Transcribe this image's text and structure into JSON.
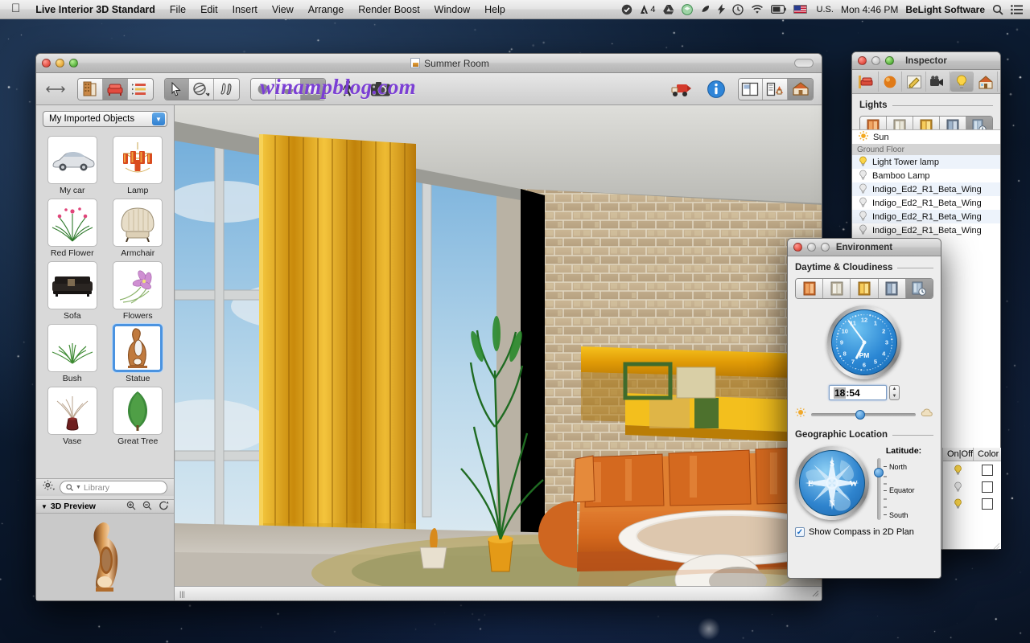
{
  "menubar": {
    "apple_icon": "apple-icon",
    "app_name": "Live Interior 3D Standard",
    "items": [
      "File",
      "Edit",
      "Insert",
      "View",
      "Arrange",
      "Render Boost",
      "Window",
      "Help"
    ],
    "status_icons": [
      "checkmark-badge-icon",
      "adobe-icon",
      "google-drive-icon",
      "dropbox-icon",
      "evernote-icon",
      "flash-icon",
      "time-machine-icon",
      "wifi-icon",
      "battery-icon"
    ],
    "adobe_badge": "4",
    "input_locale": "U.S.",
    "clock": "Mon 4:46 PM",
    "user": "BeLight Software",
    "spotlight_icon": "search-icon",
    "notification_icon": "notification-list-icon"
  },
  "main_window": {
    "document_title": "Summer Room",
    "watermark": "winampblog.com",
    "toolbar": {
      "resize_icon": "arrows-horizontal-icon",
      "view_mode": [
        {
          "name": "building-icon",
          "active": false
        },
        {
          "name": "furniture-icon",
          "active": true
        },
        {
          "name": "list-icon",
          "active": false
        }
      ],
      "tools": [
        {
          "name": "arrow-select-icon",
          "active": true
        },
        {
          "name": "orbit-icon",
          "active": false
        },
        {
          "name": "walk-tool-icon",
          "active": false
        }
      ],
      "render_modes": [
        {
          "name": "solid-sphere-icon",
          "active": false
        },
        {
          "name": "shaded-sphere-icon",
          "active": false
        },
        {
          "name": "glossy-sphere-icon",
          "active": true
        }
      ],
      "walkthrough_icon": "walking-person-icon",
      "camera_icon": "camera-icon",
      "render_boost_icon": "render-truck-icon",
      "info_icon": "info-icon",
      "layouts": [
        {
          "name": "split-view-icon",
          "active": false
        },
        {
          "name": "plan-and-3d-icon",
          "active": false
        },
        {
          "name": "3d-view-icon",
          "active": true
        }
      ]
    },
    "library": {
      "collection": "My Imported Objects",
      "objects": [
        {
          "label": "My car",
          "icon": "car-thumb",
          "selected": false
        },
        {
          "label": "Lamp",
          "icon": "chandelier-thumb",
          "selected": false
        },
        {
          "label": "Red Flower",
          "icon": "red-flower-thumb",
          "selected": false
        },
        {
          "label": "Armchair",
          "icon": "armchair-thumb",
          "selected": false
        },
        {
          "label": "Sofa",
          "icon": "sofa-thumb",
          "selected": false
        },
        {
          "label": "Flowers",
          "icon": "flowers-thumb",
          "selected": false
        },
        {
          "label": "Bush",
          "icon": "bush-thumb",
          "selected": false
        },
        {
          "label": "Statue",
          "icon": "statue-thumb",
          "selected": true
        },
        {
          "label": "Vase",
          "icon": "vase-thumb",
          "selected": false
        },
        {
          "label": "Great Tree",
          "icon": "great-tree-thumb",
          "selected": false
        }
      ],
      "gear_icon": "gear-icon",
      "search_placeholder": "Library",
      "search_icon": "search-icon",
      "preview_title": "3D Preview",
      "preview_buttons": [
        "zoom-in-icon",
        "zoom-out-icon",
        "rotate-icon"
      ]
    }
  },
  "inspector": {
    "title": "Inspector",
    "tabs": [
      {
        "name": "object-tab-icon",
        "active": false
      },
      {
        "name": "material-tab-icon",
        "active": false
      },
      {
        "name": "edit-tab-icon",
        "active": false
      },
      {
        "name": "camera-tab-icon",
        "active": false
      },
      {
        "name": "light-tab-icon",
        "active": true
      },
      {
        "name": "site-tab-icon",
        "active": false
      }
    ],
    "section_title": "Lights",
    "light_buttons": [
      {
        "name": "sunrise-window-icon",
        "active": false
      },
      {
        "name": "day-window-icon",
        "active": false
      },
      {
        "name": "sunset-window-icon",
        "active": false
      },
      {
        "name": "night-window-icon",
        "active": false
      },
      {
        "name": "custom-time-window-icon",
        "active": true
      }
    ],
    "lights": [
      {
        "label": "Sun",
        "icon": "sun-icon",
        "group": false
      },
      {
        "label": "Ground Floor",
        "group": true
      },
      {
        "label": "Light Tower lamp",
        "icon": "bulb-on-icon",
        "group": false
      },
      {
        "label": "Bamboo Lamp",
        "icon": "bulb-off-icon",
        "group": false
      },
      {
        "label": "Indigo_Ed2_R1_Beta_Wing",
        "icon": "bulb-off-icon",
        "group": false
      },
      {
        "label": "Indigo_Ed2_R1_Beta_Wing",
        "icon": "bulb-off-icon",
        "group": false
      },
      {
        "label": "Indigo_Ed2_R1_Beta_Wing",
        "icon": "bulb-off-icon",
        "group": false
      },
      {
        "label": "Indigo_Ed2_R1_Beta_Wing",
        "icon": "bulb-off-icon",
        "group": false
      }
    ],
    "table_columns": [
      "On|Off",
      "Color"
    ],
    "table_rows": [
      {
        "state": "bulb-on-icon",
        "color": "#ffffff"
      },
      {
        "state": "bulb-off-icon",
        "color": "#ffffff"
      },
      {
        "state": "bulb-on-icon",
        "color": "#ffffff"
      }
    ]
  },
  "environment": {
    "title": "Environment",
    "daytime_title": "Daytime & Cloudiness",
    "daytime_buttons": [
      {
        "name": "sunrise-window-icon",
        "active": false
      },
      {
        "name": "overcast-window-icon",
        "active": false
      },
      {
        "name": "sunny-window-icon",
        "active": false
      },
      {
        "name": "night-window-icon",
        "active": false
      },
      {
        "name": "custom-time-window-icon",
        "active": true
      }
    ],
    "clock": {
      "numerals": [
        "12",
        "1",
        "2",
        "3",
        "4",
        "5",
        "6",
        "7",
        "8",
        "9",
        "10",
        "11"
      ],
      "meridiem": "PM",
      "hour_angle": 207,
      "minute_angle": 324
    },
    "time_value": "18:54",
    "time_selected_part": "18",
    "time_rest": ":54",
    "stepper_icon": "stepper-up-down-icon",
    "sun_icon": "sun-small-icon",
    "cloud_icon": "cloud-small-icon",
    "cloud_slider_value": 42,
    "geo_title": "Geographic Location",
    "compass_icon": "compass-rose-icon",
    "latitude_label": "Latitude:",
    "latitude_ticks": [
      "North",
      "Equator",
      "South"
    ],
    "latitude_value": 16,
    "show_compass_label": "Show Compass in 2D Plan",
    "show_compass_checked": true,
    "check_glyph": "✓"
  },
  "colors": {
    "accent_blue": "#2f7fd0",
    "selection_blue": "#4b93e0",
    "curtain_orange": "#e8a21a",
    "sofa_orange": "#d4691f",
    "stone_wall": "#c3ad8d",
    "watermark_purple": "#7b3fd4"
  }
}
